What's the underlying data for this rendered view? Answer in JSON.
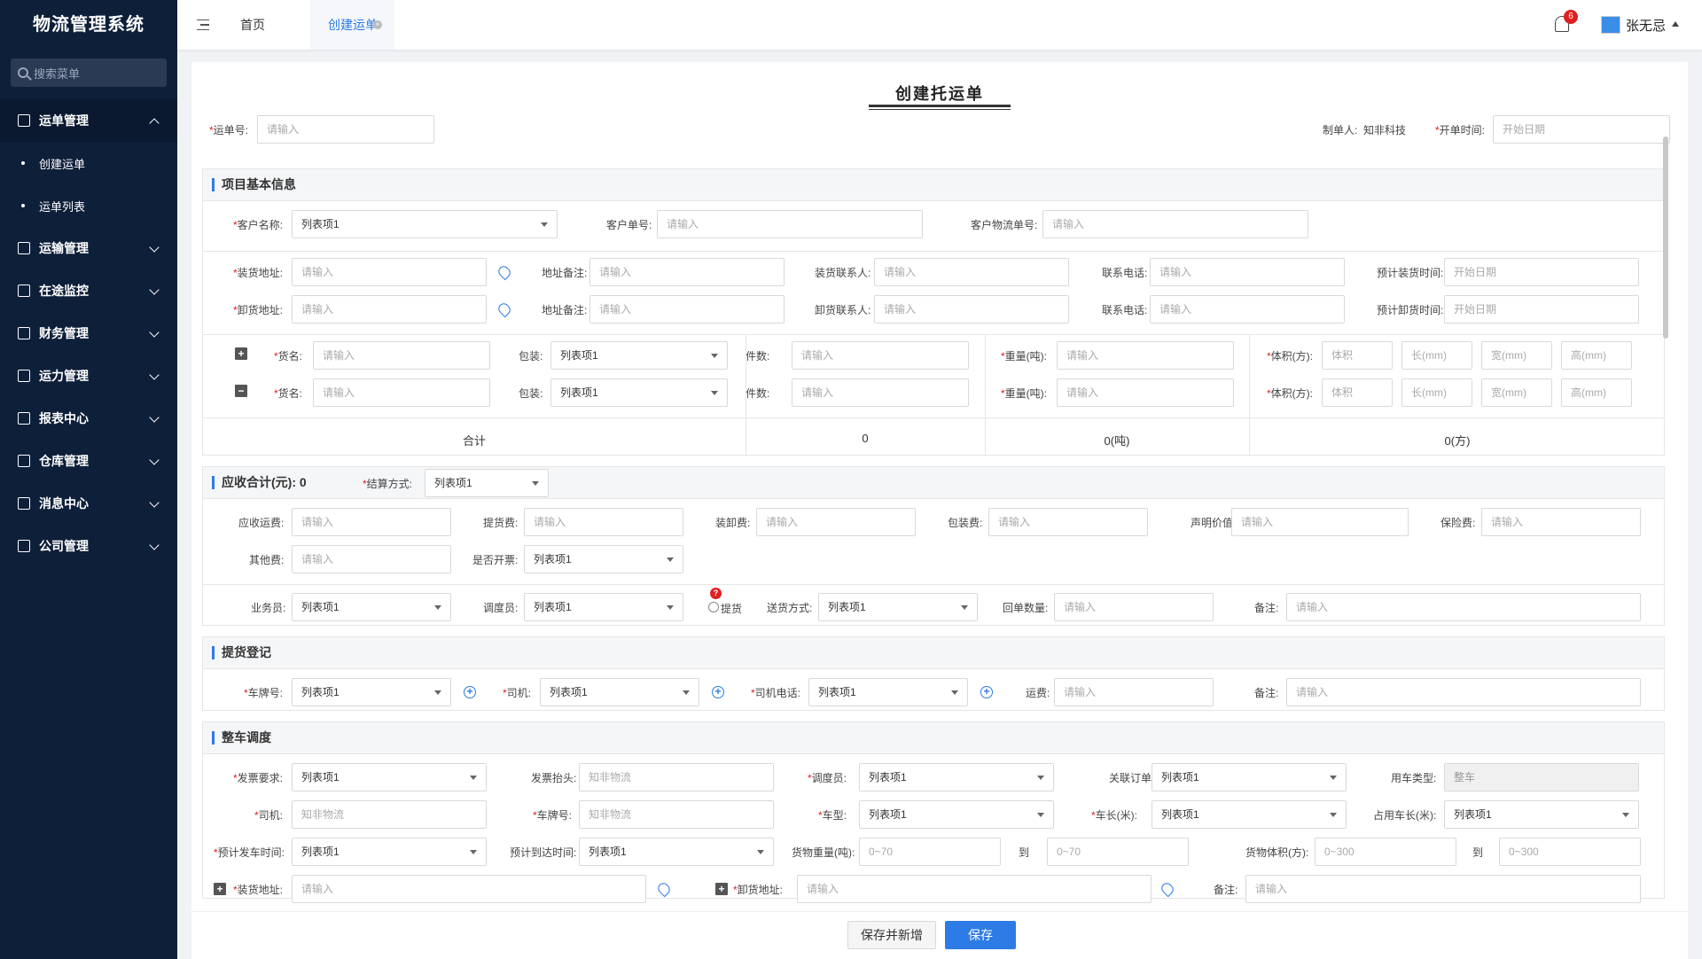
{
  "app": {
    "title": "物流管理系统"
  },
  "sidebar": {
    "search_placeholder": "搜索菜单",
    "groups": [
      {
        "label": "运单管理",
        "children": [
          {
            "label": "创建运单"
          },
          {
            "label": "运单列表"
          }
        ]
      },
      {
        "label": "运输管理"
      },
      {
        "label": "在途监控"
      },
      {
        "label": "财务管理"
      },
      {
        "label": "运力管理"
      },
      {
        "label": "报表中心"
      },
      {
        "label": "仓库管理"
      },
      {
        "label": "消息中心"
      },
      {
        "label": "公司管理"
      }
    ]
  },
  "header": {
    "tabs": [
      {
        "label": "首页"
      },
      {
        "label": "创建运单"
      }
    ],
    "notification_count": "6",
    "user_name": "张无忌"
  },
  "form": {
    "title": "创建托运单",
    "top": {
      "waybill_label": "运单号:",
      "waybill_ph": "请输入",
      "creator_label": "制单人:",
      "creator_value": "知非科技",
      "open_time_label": "开单时间:",
      "open_time_ph": "开始日期"
    },
    "basic": {
      "title": "项目基本信息",
      "customer_name_label": "客户名称:",
      "customer_name_value": "列表项1",
      "customer_no_label": "客户单号:",
      "customer_no_ph": "请输入",
      "customer_logistics_label": "客户物流单号:",
      "customer_logistics_ph": "请输入",
      "load_addr_label": "装货地址:",
      "unload_addr_label": "卸货地址:",
      "addr_note_label": "地址备注:",
      "load_contact_label": "装货联系人:",
      "unload_contact_label": "卸货联系人:",
      "phone_label": "联系电话:",
      "est_load_label": "预计装货时间:",
      "est_unload_label": "预计卸货时间:",
      "ph": "请输入",
      "date_ph": "开始日期",
      "goods_label": "货名:",
      "pack_label": "包装:",
      "pack_value": "列表项1",
      "qty_label": "件数:",
      "weight_label": "重量(吨):",
      "volume_label": "体积(方):",
      "vol_ph": "体积",
      "len_ph": "长(mm)",
      "wid_ph": "宽(mm)",
      "hei_ph": "高(mm)",
      "total_label": "合计",
      "total_qty": "0",
      "total_weight": "0(吨)",
      "total_volume": "0(方)"
    },
    "fees": {
      "title": "应收合计(元): 0",
      "settle_label": "结算方式:",
      "settle_value": "列表项1",
      "freight_label": "应收运费:",
      "pickup_fee_label": "提货费:",
      "handling_label": "装卸费:",
      "pack_fee_label": "包装费:",
      "declared_label": "声明价值:",
      "insurance_label": "保险费:",
      "other_label": "其他费:",
      "invoice_label": "是否开票:",
      "invoice_value": "列表项1",
      "salesman_label": "业务员:",
      "salesman_value": "列表项1",
      "dispatcher_label": "调度员:",
      "dispatcher_value": "列表项1",
      "pickup_radio_label": "提货",
      "pickup_badge": "?",
      "delivery_label": "送货方式:",
      "delivery_value": "列表项1",
      "receipt_label": "回单数量:",
      "remark_label": "备注:",
      "ph": "请输入"
    },
    "pickup": {
      "title": "提货登记",
      "plate_label": "车牌号:",
      "plate_value": "列表项1",
      "driver_label": "司机:",
      "driver_value": "列表项1",
      "driver_phone_label": "司机电话:",
      "driver_phone_value": "列表项1",
      "fee_label": "运费:",
      "remark_label": "备注:",
      "ph": "请输入"
    },
    "dispatch": {
      "title": "整车调度",
      "invoice_req_label": "发票要求:",
      "invoice_req_value": "列表项1",
      "invoice_head_label": "发票抬头:",
      "invoice_head_ph": "知非物流",
      "dispatcher_label": "调度员:",
      "dispatcher_value": "列表项1",
      "order_label": "关联订单:",
      "order_value": "列表项1",
      "vehicle_type_label": "用车类型:",
      "vehicle_type_value": "整车",
      "driver_label": "司机:",
      "driver_ph": "知非物流",
      "plate_label": "车牌号:",
      "plate_ph": "知非物流",
      "model_label": "车型:",
      "model_value": "列表项1",
      "length_label": "车长(米):",
      "length_value": "列表项1",
      "occupy_label": "占用车长(米):",
      "occupy_value": "列表项1",
      "depart_label": "预计发车时间:",
      "depart_value": "列表项1",
      "arrive_label": "预计到达时间:",
      "arrive_value": "列表项1",
      "cargo_weight_label": "货物重量(吨):",
      "weight_ph": "0~70",
      "to_label": "到",
      "cargo_volume_label": "货物体积(方):",
      "volume_ph": "0~300",
      "load_addr_label": "装货地址:",
      "unload_addr_label": "卸货地址:",
      "remark_label": "备注:",
      "ph": "请输入"
    }
  },
  "footer": {
    "save_new_label": "保存并新增",
    "save_label": "保存"
  },
  "colors": {
    "primary": "#2d7be5",
    "sidebar": "#0e1f3a",
    "danger": "#e02020"
  }
}
